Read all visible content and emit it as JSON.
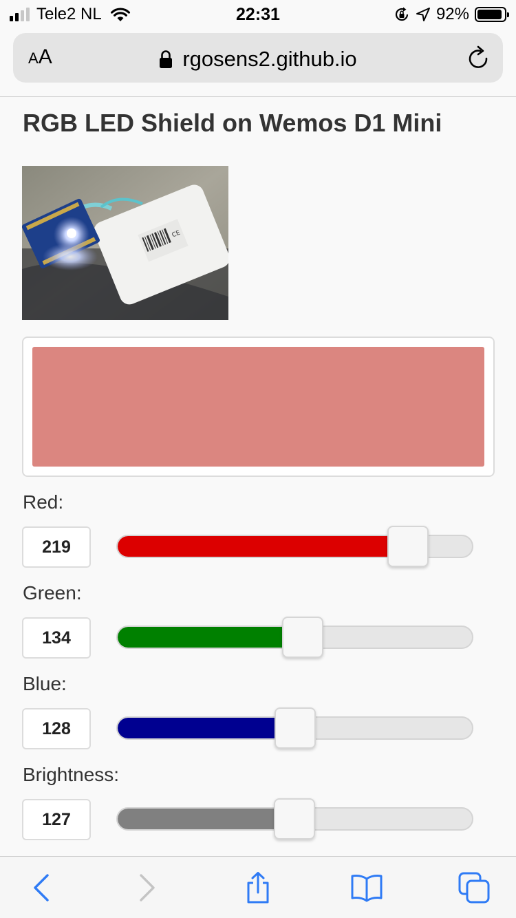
{
  "status_bar": {
    "carrier": "Tele2 NL",
    "time": "22:31",
    "battery_percent": "92%",
    "battery_level": 0.92,
    "signal_bars_active": 2,
    "signal_bars_total": 4
  },
  "browser": {
    "text_size_label_small": "A",
    "text_size_label_large": "A",
    "url": "rgosens2.github.io"
  },
  "page": {
    "title": "RGB LED Shield on Wemos D1 Mini",
    "preview_color": "#db8680",
    "controls": [
      {
        "label": "Red:",
        "value": "219",
        "level": 219,
        "max": 255,
        "color": "#dc0000"
      },
      {
        "label": "Green:",
        "value": "134",
        "level": 134,
        "max": 255,
        "color": "#008000"
      },
      {
        "label": "Blue:",
        "value": "128",
        "level": 128,
        "max": 255,
        "color": "#000090"
      },
      {
        "label": "Brightness:",
        "value": "127",
        "level": 127,
        "max": 255,
        "color": "#808080"
      }
    ]
  },
  "toolbar": {
    "accent_color": "#2f7bf5",
    "disabled_color": "#c4c4c4",
    "icons": [
      "back-icon",
      "forward-icon",
      "share-icon",
      "bookmarks-icon",
      "tabs-icon"
    ]
  }
}
